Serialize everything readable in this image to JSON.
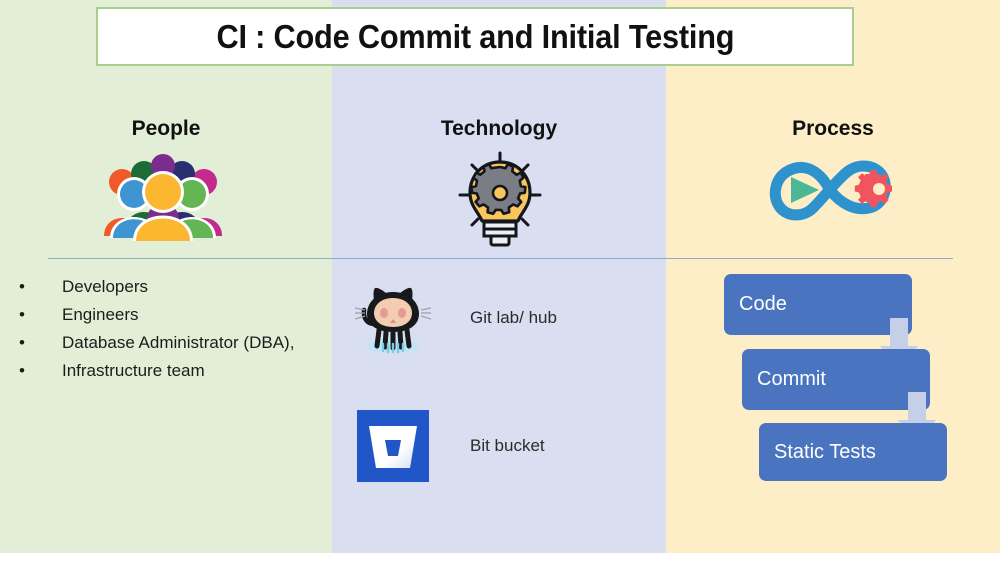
{
  "slide": {
    "title": "CI : Code Commit and Initial Testing",
    "colors": {
      "panel_people": "#e3eed7",
      "panel_technology": "#d9dff1",
      "panel_process": "#fdeec8",
      "title_border": "#a9cf8e",
      "divider": "#8ea9ce",
      "flow_box": "#4a74c0",
      "flow_arrow": "#c5cfe8"
    }
  },
  "columns": {
    "people": {
      "heading": "People",
      "icon": "people-group-icon",
      "bullets": [
        {
          "marker": "•",
          "text": "Developers"
        },
        {
          "marker": "•",
          "text": "Engineers"
        },
        {
          "marker": "•",
          "text": "Database Administrator (DBA),"
        },
        {
          "marker": "•",
          "text": "Infrastructure team"
        }
      ]
    },
    "technology": {
      "heading": "Technology",
      "icon": "lightbulb-gear-icon",
      "tools": [
        {
          "logo": "github-octocat-icon",
          "label": "Git lab/ hub"
        },
        {
          "logo": "bitbucket-icon",
          "label": "Bit bucket"
        }
      ]
    },
    "process": {
      "heading": "Process",
      "icon": "devops-infinity-icon",
      "flow": [
        {
          "label": "Code"
        },
        {
          "label": "Commit"
        },
        {
          "label": "Static Tests"
        }
      ],
      "arrows": [
        "down-arrow-icon",
        "down-arrow-icon"
      ]
    }
  }
}
